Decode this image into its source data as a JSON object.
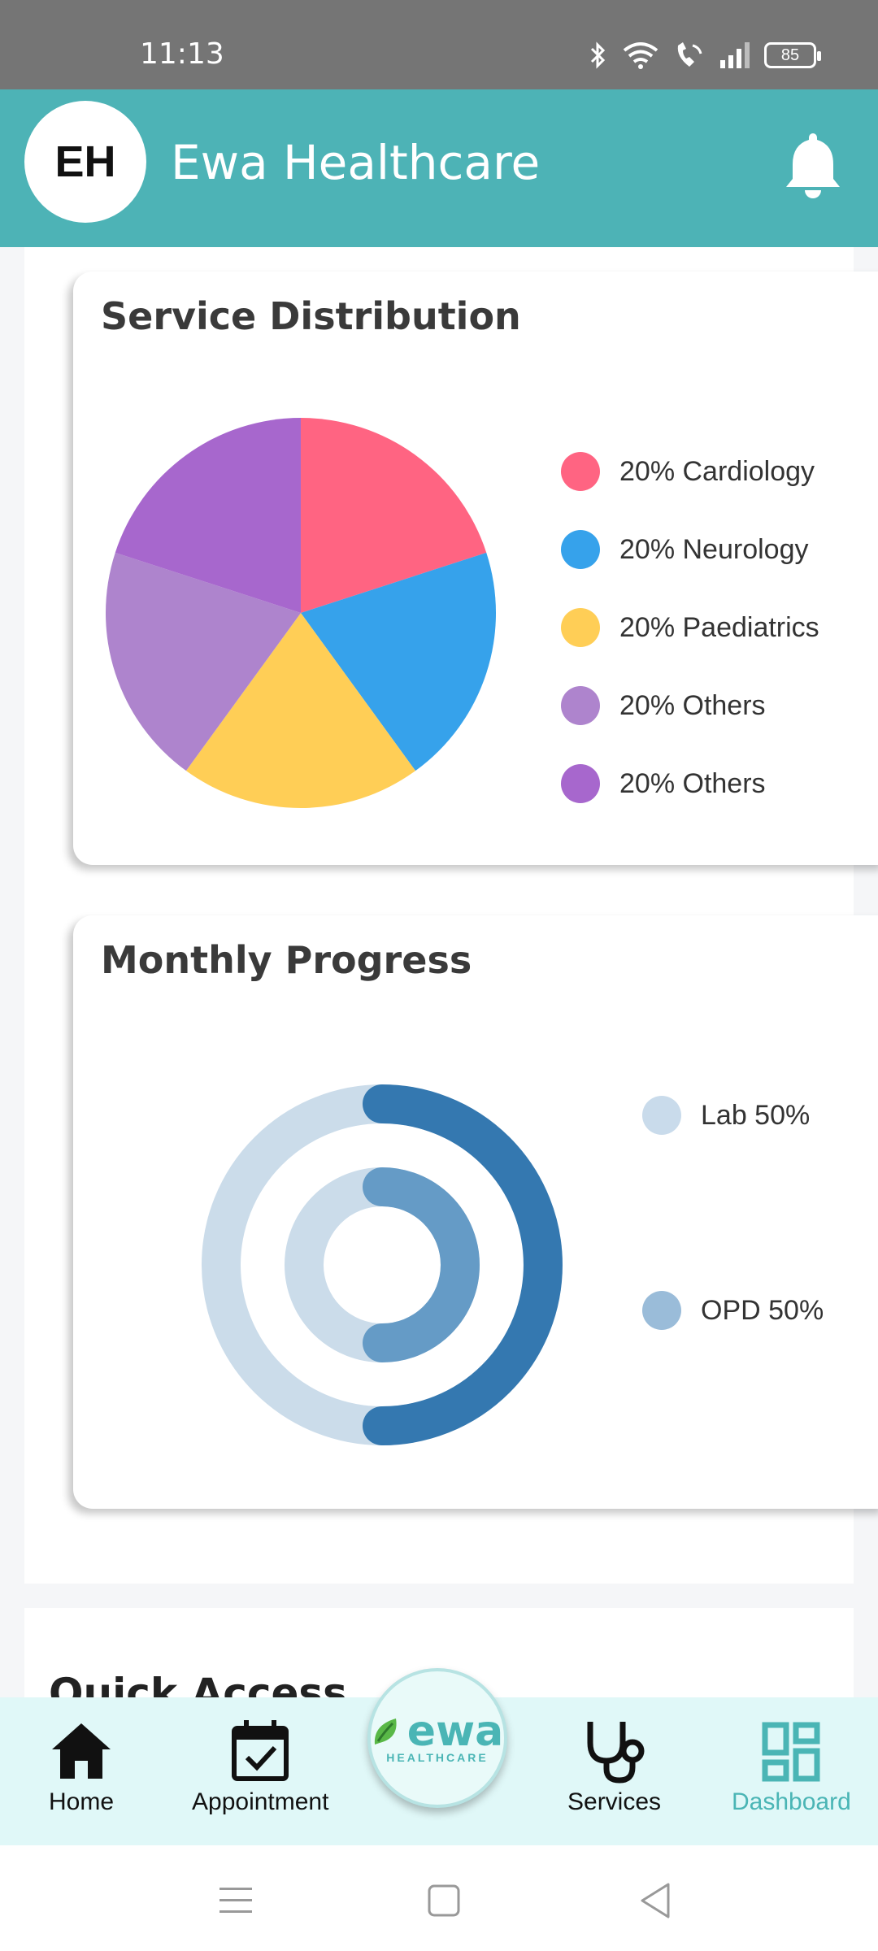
{
  "status_bar": {
    "time": "11:13",
    "battery": "85"
  },
  "app_bar": {
    "avatar_initials": "EH",
    "title": "Ewa Healthcare",
    "color": "#4db3b6"
  },
  "service_distribution": {
    "title": "Service Distribution",
    "legend": [
      {
        "label": "20% Cardiology",
        "color": "#ff6482"
      },
      {
        "label": "20% Neurology",
        "color": "#36a2eb"
      },
      {
        "label": "20% Paediatrics",
        "color": "#ffce56"
      },
      {
        "label": "20% Others",
        "color": "#ae84cd"
      },
      {
        "label": "20% Others",
        "color": "#a767cd"
      }
    ]
  },
  "monthly_progress": {
    "title": "Monthly Progress",
    "legend": [
      {
        "label": "Lab 50%",
        "color": "#c9dbeb"
      },
      {
        "label": "OPD 50%",
        "color": "#9abcd9"
      }
    ]
  },
  "chart_data": [
    {
      "type": "pie",
      "title": "Service Distribution",
      "categories": [
        "Cardiology",
        "Neurology",
        "Paediatrics",
        "Others",
        "Others"
      ],
      "values": [
        20,
        20,
        20,
        20,
        20
      ],
      "colors": [
        "#ff6482",
        "#36a2eb",
        "#ffce56",
        "#ae84cd",
        "#a767cd"
      ],
      "legend": "right"
    },
    {
      "type": "pie",
      "title": "Monthly Progress",
      "categories": [
        "Lab",
        "OPD"
      ],
      "series": [
        {
          "name": "Lab",
          "value": 50,
          "color": "#3478b0",
          "track": "#cbdcea"
        },
        {
          "name": "OPD",
          "value": 50,
          "color": "#659bc6",
          "track": "#cbdcea"
        }
      ],
      "legend": "right"
    }
  ],
  "quick_access": {
    "title": "Quick Access"
  },
  "bottom_nav": {
    "items": [
      {
        "label": "Home"
      },
      {
        "label": "Appointment"
      },
      {
        "label": "Services"
      },
      {
        "label": "Dashboard"
      }
    ],
    "logo_main": "ewa",
    "logo_sub": "HEALTHCARE",
    "active_color": "#4ab5b5"
  }
}
